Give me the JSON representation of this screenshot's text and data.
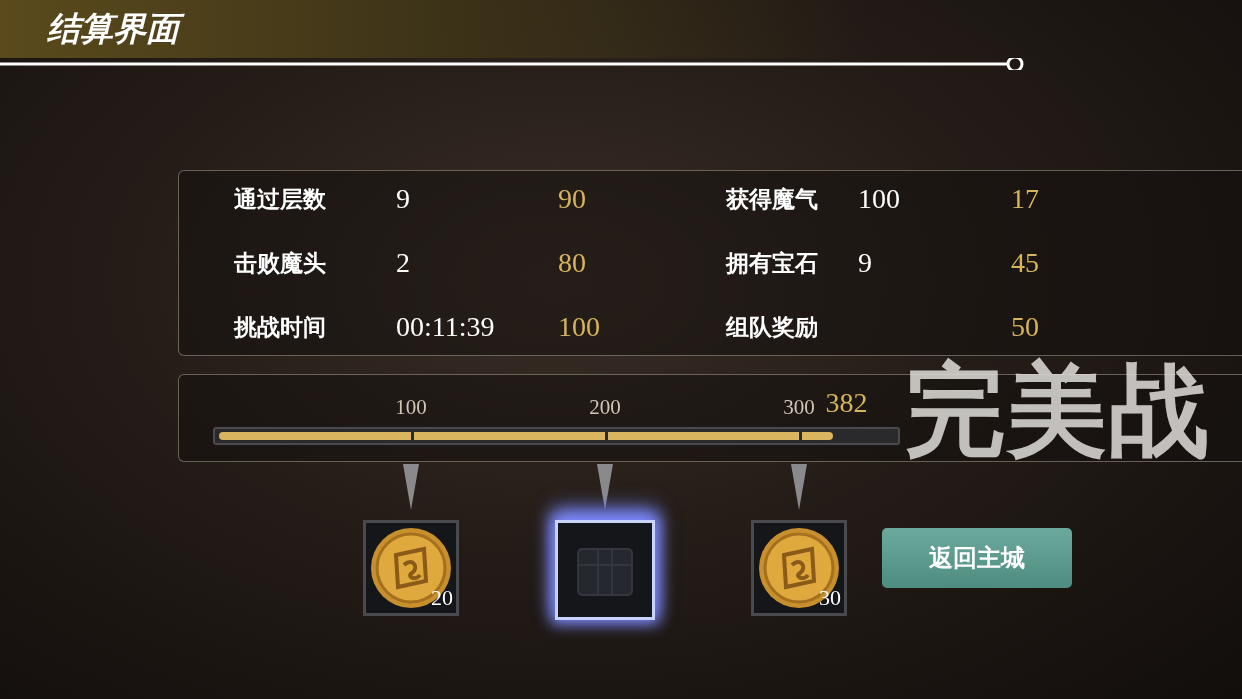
{
  "header": {
    "title": "结算界面"
  },
  "stats": [
    {
      "label": "通过层数",
      "value": "9",
      "points": "90"
    },
    {
      "label": "获得魔气",
      "value": "100",
      "points": "17"
    },
    {
      "label": "击败魔头",
      "value": "2",
      "points": "80"
    },
    {
      "label": "拥有宝石",
      "value": "9",
      "points": "45"
    },
    {
      "label": "挑战时间",
      "value": "00:11:39",
      "points": "100"
    },
    {
      "label": "组队奖励",
      "points": "50"
    }
  ],
  "progress": {
    "milestones": [
      "100",
      "200",
      "300"
    ],
    "total": "382",
    "level": 0.91
  },
  "stamp": "完美战",
  "rewards": [
    {
      "kind": "coin",
      "count": "20",
      "highlighted": false
    },
    {
      "kind": "chest",
      "highlighted": true
    },
    {
      "kind": "coin",
      "count": "30",
      "highlighted": false
    }
  ],
  "button": "返回主城"
}
